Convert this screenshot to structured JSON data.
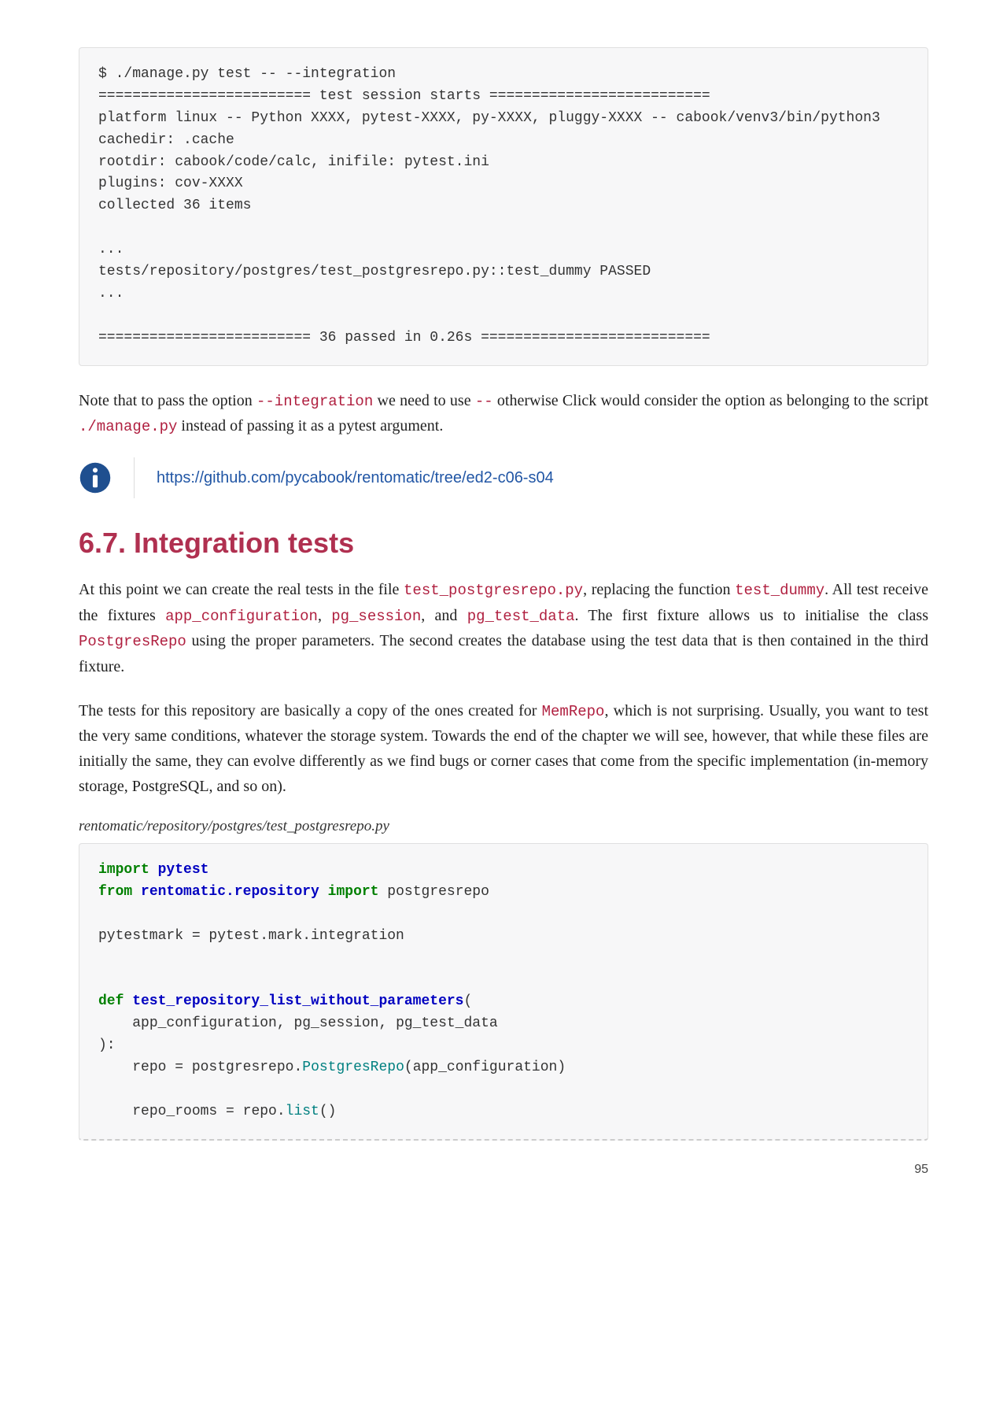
{
  "code_top": "$ ./manage.py test -- --integration\n========================= test session starts ==========================\nplatform linux -- Python XXXX, pytest-XXXX, py-XXXX, pluggy-XXXX -- cabook/venv3/bin/python3\ncachedir: .cache\nrootdir: cabook/code/calc, inifile: pytest.ini\nplugins: cov-XXXX\ncollected 36 items\n\n...\ntests/repository/postgres/test_postgresrepo.py::test_dummy PASSED\n...\n\n========================= 36 passed in 0.26s ===========================",
  "para1": {
    "pre1": "Note that to pass the option ",
    "c1": "--integration",
    "mid1": " we need to use ",
    "c2": "--",
    "mid2": " otherwise Click would consider the option as belonging to the script ",
    "c3": "./manage.py",
    "post": " instead of passing it as a pytest argument."
  },
  "note_link": "https://github.com/pycabook/rentomatic/tree/ed2-c06-s04",
  "section_title": "6.7. Integration tests",
  "para2": {
    "t1": "At this point we can create the real tests in the file ",
    "c1": "test_postgresrepo.py",
    "t2": ", replacing the function ",
    "c2": "test_dummy",
    "t3": ". All test receive the fixtures ",
    "c3": "app_configuration",
    "t4": ", ",
    "c4": "pg_session",
    "t5": ", and ",
    "c5": "pg_test_data",
    "t6": ". The first fixture allows us to initialise the class ",
    "c6": "PostgresRepo",
    "t7": " using the proper parameters. The second creates the database using the test data that is then contained in the third fixture."
  },
  "para3": {
    "t1": "The tests for this repository are basically a copy of the ones created for ",
    "c1": "MemRepo",
    "t2": ", which is not surprising. Usually, you want to test the very same conditions, whatever the storage system. Towards the end of the chapter we will see, however, that while these files are initially the same, they can evolve differently as we find bugs or corner cases that come from the specific implementation (in-memory storage, PostgreSQL, and so on)."
  },
  "caption": "rentomatic/repository/postgres/test_postgresrepo.py",
  "code_bottom": {
    "l1_import": "import",
    "l1_pytest": " pytest",
    "l2_from": "from",
    "l2_mod": " rentomatic.repository",
    "l2_import": " import",
    "l2_name": " postgresrepo",
    "l3": "pytestmark = pytest.mark.integration",
    "l4_def": "def",
    "l4_name": " test_repository_list_without_parameters",
    "l4_open": "(",
    "l5": "    app_configuration, pg_session, pg_test_data",
    "l6": "):",
    "l7_pre": "    repo = postgresrepo.",
    "l7_call": "PostgresRepo",
    "l7_post": "(app_configuration)",
    "l8_pre": "    repo_rooms = repo.",
    "l8_call": "list",
    "l8_post": "()"
  },
  "page_number": "95"
}
